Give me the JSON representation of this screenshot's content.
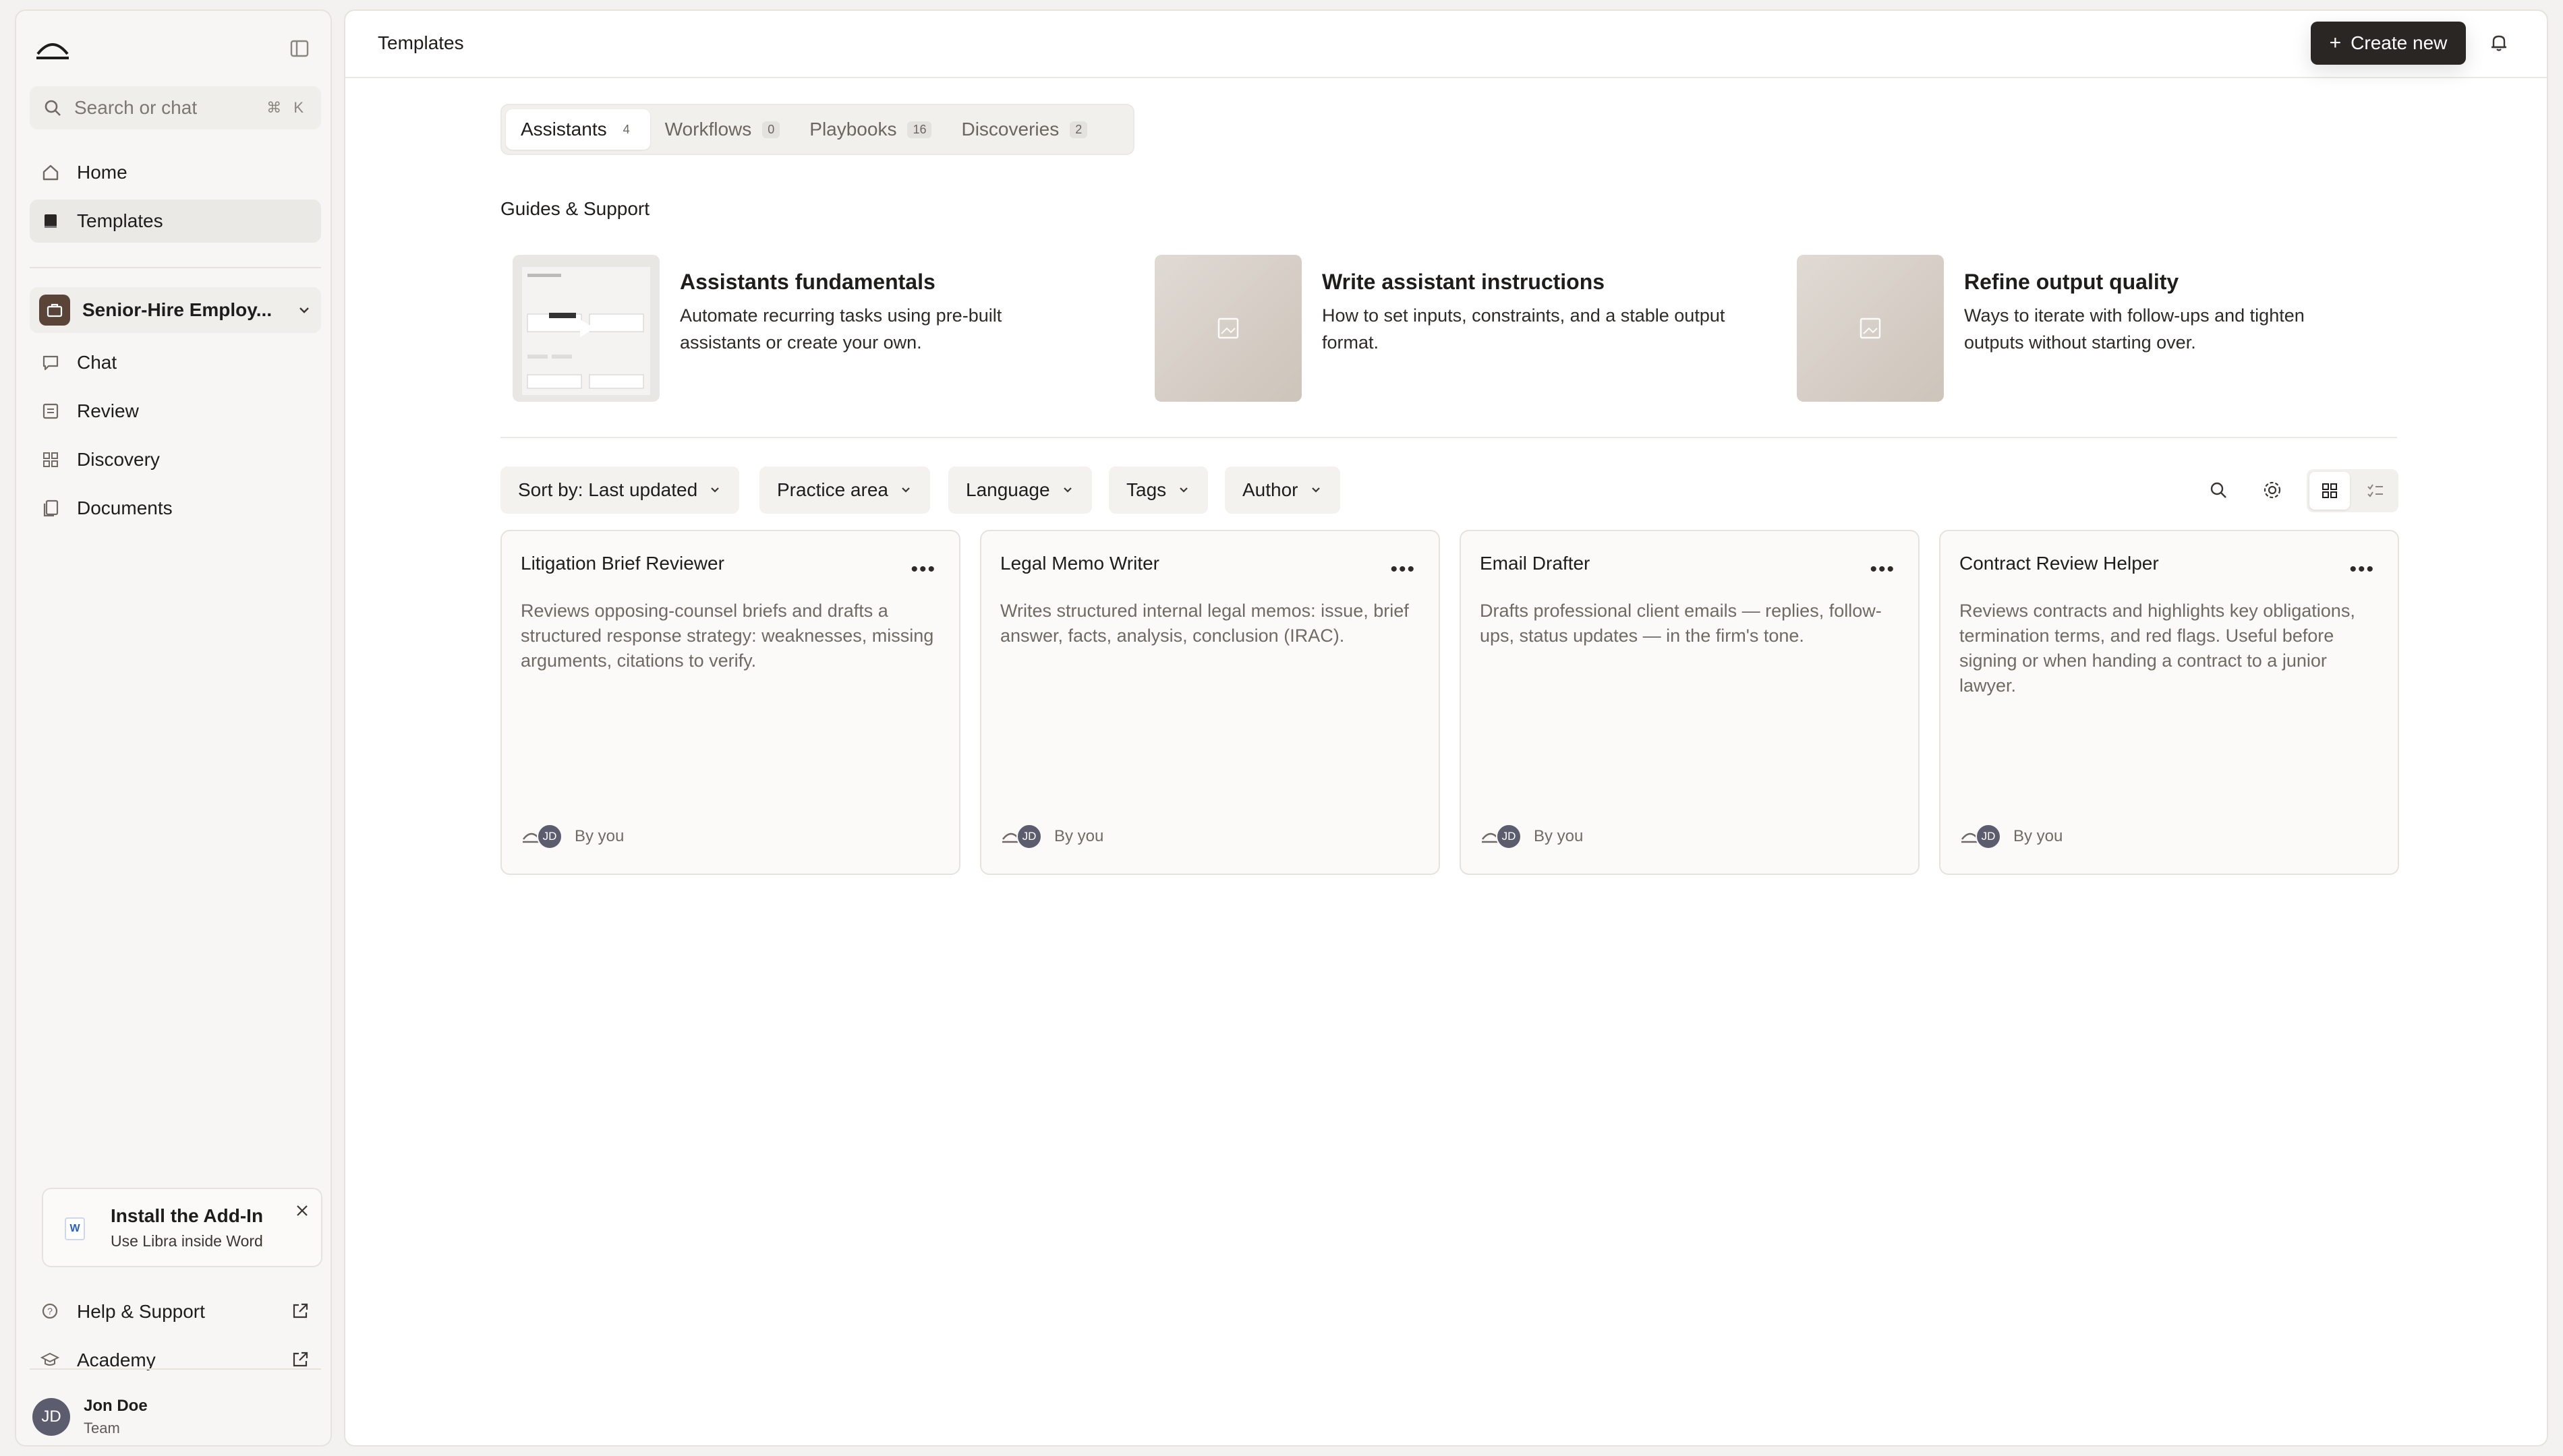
{
  "sidebar": {
    "search_placeholder": "Search or chat",
    "search_shortcut": "⌘ K",
    "nav": [
      {
        "label": "Home",
        "icon": "home-icon"
      },
      {
        "label": "Templates",
        "icon": "book-icon",
        "active": true
      }
    ],
    "workspace": {
      "name": "Senior-Hire Employ...",
      "icon": "briefcase-icon"
    },
    "workspace_nav": [
      {
        "label": "Chat",
        "icon": "chat-icon"
      },
      {
        "label": "Review",
        "icon": "review-icon"
      },
      {
        "label": "Discovery",
        "icon": "grid-icon"
      },
      {
        "label": "Documents",
        "icon": "documents-icon"
      }
    ],
    "addin": {
      "title": "Install the Add-In",
      "subtitle": "Use Libra inside Word",
      "badge": "W"
    },
    "links": [
      {
        "label": "Help & Support",
        "icon": "help-icon"
      },
      {
        "label": "Academy",
        "icon": "academy-icon"
      }
    ],
    "user": {
      "initials": "JD",
      "name": "Jon Doe",
      "role": "Team"
    }
  },
  "header": {
    "title": "Templates",
    "create_label": "Create new",
    "create_icon": "+"
  },
  "tabs": [
    {
      "label": "Assistants",
      "count": "4",
      "active": true
    },
    {
      "label": "Workflows",
      "count": "0"
    },
    {
      "label": "Playbooks",
      "count": "16"
    },
    {
      "label": "Discoveries",
      "count": "2"
    }
  ],
  "guides": {
    "title": "Guides & Support",
    "items": [
      {
        "title": "Assistants fundamentals",
        "desc": "Automate recurring tasks using pre-built assistants or create your own."
      },
      {
        "title": "Write assistant instructions",
        "desc": "How to set inputs, constraints, and a stable output format."
      },
      {
        "title": "Refine output quality",
        "desc": "Ways to iterate with follow-ups and tighten outputs without starting over."
      }
    ]
  },
  "filters": {
    "sort": "Sort by: Last updated",
    "practice_area": "Practice area",
    "language": "Language",
    "tags": "Tags",
    "author": "Author"
  },
  "cards": [
    {
      "title": "Litigation Brief Reviewer",
      "desc": "Reviews opposing-counsel briefs and drafts a structured response strategy: weaknesses, missing arguments, citations to verify.",
      "initials": "JD",
      "by": "By you"
    },
    {
      "title": "Legal Memo Writer",
      "desc": "Writes structured internal legal memos: issue, brief answer, facts, analysis, conclusion (IRAC).",
      "initials": "JD",
      "by": "By you"
    },
    {
      "title": "Email Drafter",
      "desc": "Drafts professional client emails — replies, follow-ups, status updates — in the firm's tone.",
      "initials": "JD",
      "by": "By you"
    },
    {
      "title": "Contract Review Helper",
      "desc": "Reviews contracts and highlights key obligations, termination terms, and red flags. Useful before signing or when handing a contract to a junior lawyer.",
      "initials": "JD",
      "by": "By you"
    }
  ],
  "colors": {
    "primary_button": "#2a2624",
    "avatar": "#5b5d6e",
    "workspace_icon": "#5a4438"
  }
}
